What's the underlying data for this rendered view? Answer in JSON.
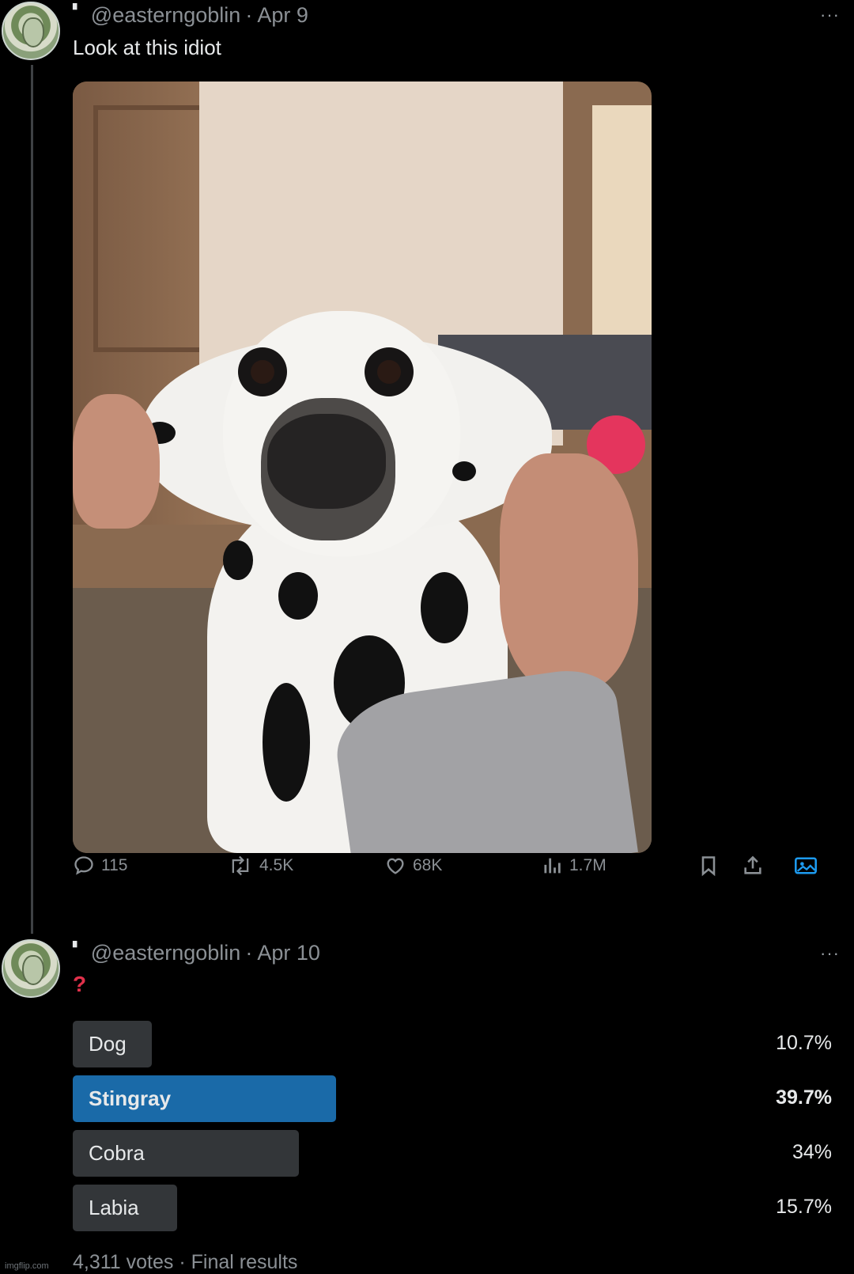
{
  "tweet1": {
    "handle": "@easterngoblin",
    "separator": "·",
    "date": "Apr 9",
    "more": "···",
    "text": "Look at this idiot",
    "stats": {
      "replies": "115",
      "retweets": "4.5K",
      "likes": "68K",
      "views": "1.7M"
    }
  },
  "tweet2": {
    "handle": "@easterngoblin",
    "separator": "·",
    "date": "Apr 10",
    "more": "···",
    "text": "?"
  },
  "poll": {
    "options": [
      {
        "label": "Dog",
        "percent_text": "10.7%",
        "percent": 10.7
      },
      {
        "label": "Stingray",
        "percent_text": "39.7%",
        "percent": 39.7
      },
      {
        "label": "Cobra",
        "percent_text": "34%",
        "percent": 34
      },
      {
        "label": "Labia",
        "percent_text": "15.7%",
        "percent": 15.7
      }
    ],
    "winner_index": 1,
    "footer": "4,311 votes · Final results"
  },
  "watermark": "imgflip.com",
  "colors": {
    "background": "#000000",
    "poll_winner": "#1a6aa8",
    "poll_other": "#333639",
    "question_mark": "#e0314b"
  }
}
